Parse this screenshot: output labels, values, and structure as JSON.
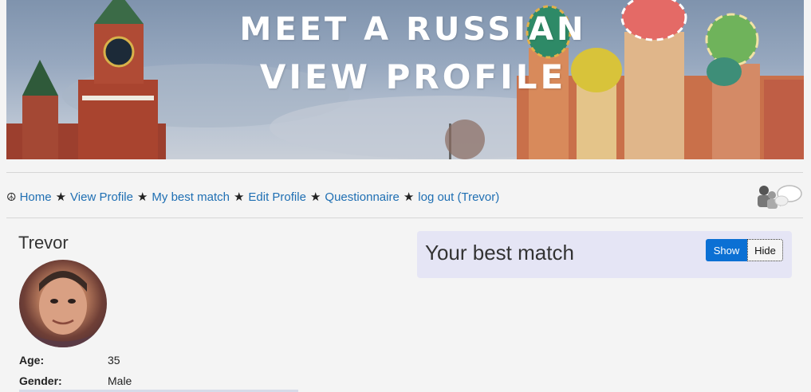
{
  "banner": {
    "line1": "MEET A RUSSIAN",
    "line2": "VIEW PROFILE"
  },
  "nav": {
    "peace_symbol": "☮",
    "separator": "★",
    "items": [
      {
        "label": "Home"
      },
      {
        "label": "View Profile"
      },
      {
        "label": "My best match"
      },
      {
        "label": "Edit Profile"
      },
      {
        "label": "Questionnaire"
      },
      {
        "label": "log out (Trevor)"
      }
    ],
    "chat_icon": "chat-users-icon"
  },
  "profile": {
    "name": "Trevor",
    "avatar": "profile-photo",
    "fields": [
      {
        "label": "Age:",
        "value": "35"
      },
      {
        "label": "Gender:",
        "value": "Male"
      }
    ]
  },
  "best_match": {
    "title": "Your best match",
    "show_label": "Show",
    "hide_label": "Hide",
    "accent_color": "#0b70d4",
    "panel_color": "#e5e5f5"
  }
}
